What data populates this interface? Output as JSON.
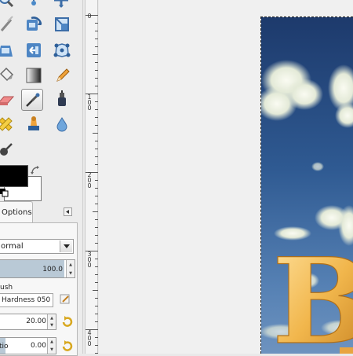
{
  "toolbox": {
    "tools": [
      {
        "name": "zoom-icon"
      },
      {
        "name": "measure-icon"
      },
      {
        "name": "move-icon"
      },
      {
        "name": "knife-icon"
      },
      {
        "name": "transform-icon"
      },
      {
        "name": "perspective-icon"
      },
      {
        "name": "flip-icon"
      },
      {
        "name": "scale-icon"
      },
      {
        "name": "cage-icon"
      },
      {
        "name": "bucket-fill-icon"
      },
      {
        "name": "blend-icon"
      },
      {
        "name": "pencil-icon"
      },
      {
        "name": "eraser-icon"
      },
      {
        "name": "airbrush-icon"
      },
      {
        "name": "ink-icon"
      },
      {
        "name": "heal-icon"
      },
      {
        "name": "clone-icon"
      },
      {
        "name": "blur-icon"
      },
      {
        "name": "dodge-icon"
      }
    ],
    "active_tool": "airbrush-icon",
    "colors": {
      "foreground": "#000000",
      "background": "#ffffff"
    }
  },
  "options": {
    "tab_label": "Options",
    "mode_value": "ormal",
    "opacity_value": "100.0",
    "brush_label": "ush",
    "brush_value": "Hardness 050",
    "size_value": "20.00",
    "ratio_label": "tio",
    "ratio_value": "0.00"
  },
  "ruler": {
    "labels": [
      "0",
      "100",
      "200",
      "300",
      "400"
    ]
  },
  "canvas": {
    "image_text": "B"
  }
}
